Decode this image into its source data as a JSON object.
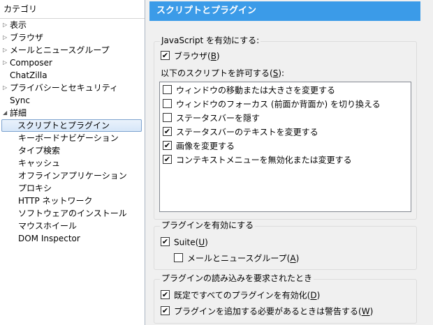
{
  "tree": {
    "header": "カテゴリ",
    "items": [
      {
        "label": "表示",
        "level": 0,
        "twisty": "▷"
      },
      {
        "label": "ブラウザ",
        "level": 0,
        "twisty": "▷"
      },
      {
        "label": "メールとニュースグループ",
        "level": 0,
        "twisty": "▷"
      },
      {
        "label": "Composer",
        "level": 0,
        "twisty": "▷"
      },
      {
        "label": "ChatZilla",
        "level": 0,
        "twisty": ""
      },
      {
        "label": "プライバシーとセキュリティ",
        "level": 0,
        "twisty": "▷"
      },
      {
        "label": "Sync",
        "level": 0,
        "twisty": ""
      },
      {
        "label": "詳細",
        "level": 0,
        "twisty": "◢"
      },
      {
        "label": "スクリプトとプラグイン",
        "level": 1,
        "twisty": "",
        "selected": true
      },
      {
        "label": "キーボードナビゲーション",
        "level": 1,
        "twisty": ""
      },
      {
        "label": "タイプ検索",
        "level": 1,
        "twisty": ""
      },
      {
        "label": "キャッシュ",
        "level": 1,
        "twisty": ""
      },
      {
        "label": "オフラインアプリケーション",
        "level": 1,
        "twisty": ""
      },
      {
        "label": "プロキシ",
        "level": 1,
        "twisty": ""
      },
      {
        "label": "HTTP ネットワーク",
        "level": 1,
        "twisty": ""
      },
      {
        "label": "ソフトウェアのインストール",
        "level": 1,
        "twisty": ""
      },
      {
        "label": "マウスホイール",
        "level": 1,
        "twisty": ""
      },
      {
        "label": "DOM Inspector",
        "level": 1,
        "twisty": ""
      }
    ]
  },
  "pane": {
    "title": "スクリプトとプラグイン",
    "javascript": {
      "legend": "JavaScript を有効にする:",
      "browser": {
        "label": "ブラウザ(",
        "key": "B",
        "tail": ")",
        "checked": true
      },
      "allow_label": {
        "text": "以下のスクリプトを許可する(",
        "key": "S",
        "tail": "):"
      },
      "scripts": [
        {
          "label": "ウィンドウの移動または大きさを変更する",
          "checked": false
        },
        {
          "label": "ウィンドウのフォーカス (前面か背面か) を切り換える",
          "checked": false
        },
        {
          "label": "ステータスバーを隠す",
          "checked": false
        },
        {
          "label": "ステータスバーのテキストを変更する",
          "checked": true
        },
        {
          "label": "画像を変更する",
          "checked": true
        },
        {
          "label": "コンテキストメニューを無効化または変更する",
          "checked": true
        }
      ]
    },
    "plugins": {
      "legend": "プラグインを有効にする",
      "suite": {
        "label": "Suite(",
        "key": "U",
        "tail": ")",
        "checked": true
      },
      "mail": {
        "label": "メールとニュースグループ(",
        "key": "A",
        "tail": ")",
        "checked": false
      }
    },
    "plugin_loading": {
      "legend": "プラグインの読み込みを要求されたとき",
      "default_all": {
        "label": "既定ですべてのプラグインを有効化(",
        "key": "D",
        "tail": ")",
        "checked": true
      },
      "warn": {
        "label": "プラグインを追加する必要があるときは警告する(",
        "key": "W",
        "tail": ")",
        "checked": true
      }
    },
    "check_glyph": "✔"
  }
}
